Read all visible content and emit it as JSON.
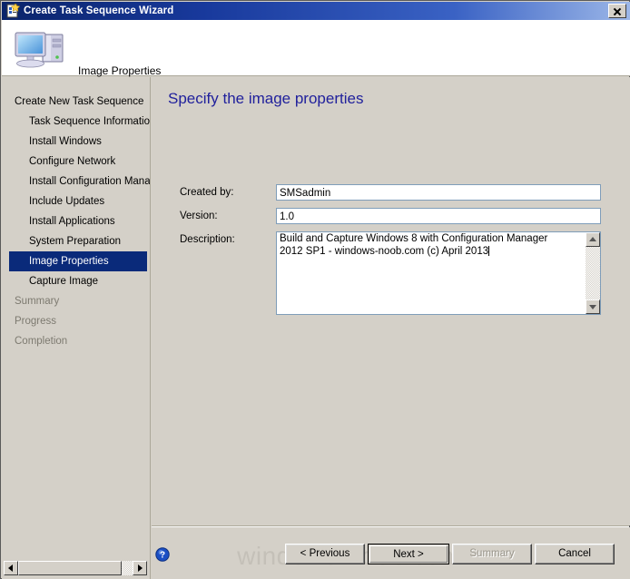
{
  "window": {
    "title": "Create Task Sequence Wizard",
    "title_icon": "task-sequence-clipboard-icon",
    "close_label": "Close",
    "accent_title_color": "#0a246a",
    "selected_nav_color": "#0a2a7a",
    "heading_color": "#21219c"
  },
  "banner": {
    "icon": "computer-icon",
    "title": "Image Properties"
  },
  "sidebar": {
    "items": [
      {
        "label": "Create New Task Sequence",
        "indent": false,
        "state": "normal"
      },
      {
        "label": "Task Sequence Information",
        "indent": true,
        "state": "normal"
      },
      {
        "label": "Install Windows",
        "indent": true,
        "state": "normal"
      },
      {
        "label": "Configure Network",
        "indent": true,
        "state": "normal"
      },
      {
        "label": "Install Configuration Manag",
        "indent": true,
        "state": "normal"
      },
      {
        "label": "Include Updates",
        "indent": true,
        "state": "normal"
      },
      {
        "label": "Install Applications",
        "indent": true,
        "state": "normal"
      },
      {
        "label": "System Preparation",
        "indent": true,
        "state": "normal"
      },
      {
        "label": "Image Properties",
        "indent": true,
        "state": "selected"
      },
      {
        "label": "Capture Image",
        "indent": true,
        "state": "normal"
      },
      {
        "label": "Summary",
        "indent": false,
        "state": "disabled"
      },
      {
        "label": "Progress",
        "indent": false,
        "state": "disabled"
      },
      {
        "label": "Completion",
        "indent": false,
        "state": "disabled"
      }
    ]
  },
  "main": {
    "heading": "Specify the image properties",
    "fields": {
      "created_by": {
        "label": "Created by:",
        "value": "SMSadmin",
        "placeholder": ""
      },
      "version": {
        "label": "Version:",
        "value": "1.0",
        "placeholder": ""
      },
      "description": {
        "label": "Description:",
        "value": "Build and Capture Windows 8 with Configuration Manager 2012 SP1 - windows-noob.com (c) April 2013",
        "placeholder": ""
      }
    }
  },
  "footer": {
    "help_icon": "help-question-icon",
    "watermark": "windows-noob.com",
    "buttons": [
      {
        "label": "< Previous",
        "state": "normal",
        "name": "previous-button"
      },
      {
        "label": "Next >",
        "state": "default",
        "name": "next-button"
      },
      {
        "label": "Summary",
        "state": "disabled",
        "name": "summary-button"
      },
      {
        "label": "Cancel",
        "state": "normal",
        "name": "cancel-button"
      }
    ]
  }
}
